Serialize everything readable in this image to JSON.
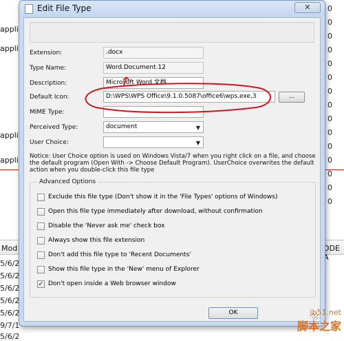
{
  "background": {
    "left_words": [
      "applic",
      "applic",
      "applic",
      "applic"
    ],
    "right_numbers": [
      "0",
      "0",
      "0",
      "0",
      "0",
      "0",
      "0",
      "0",
      "0",
      "0",
      "0",
      "0",
      "0",
      "0",
      "0"
    ],
    "table": {
      "col_left": "Mod",
      "col_right": "DDE A",
      "dates": [
        "5/6/2",
        "5/6/2",
        "5/6/2",
        "5/6/2",
        "5/6/2",
        "9/7/1",
        "5/6/2"
      ]
    }
  },
  "dialog": {
    "title": "Edit File Type",
    "close_label": "✕",
    "fields": {
      "extension_label": "Extension:",
      "extension_value": ".docx",
      "typename_label": "Type Name:",
      "typename_value": "Word.Document.12",
      "description_label": "Description:",
      "description_value": "Microsoft Word 文档",
      "icon_label": "Default Icon:",
      "icon_value": "D:\\WPS\\WPS Office\\9.1.0.5087\\office6\\wps.exe,3",
      "browse_label": "...",
      "mime_label": "MIME Type:",
      "mime_value": "",
      "perceived_label": "Perceived Type:",
      "perceived_value": "document",
      "userchoice_label": "User Choice:",
      "userchoice_value": ""
    },
    "notice": "Notice: User Choice option is used on Windows Vista/7 when you right click on a file, and choose the default program (Open With -> Choose Default Program). UserChoice overwrites the default action when you double-click this file type",
    "advanced": {
      "title": "Advanced Options",
      "options": [
        {
          "label": "Exclude  this file type (Don't show it in the 'File Types' options of Windows)",
          "checked": false
        },
        {
          "label": "Open this file type immediately after download, without confirmation",
          "checked": false
        },
        {
          "label": "Disable the 'Never ask me' check box",
          "checked": false
        },
        {
          "label": "Always show this file extension",
          "checked": false
        },
        {
          "label": "Don't add this file type to 'Recent Documents'",
          "checked": false
        },
        {
          "label": "Show this file type in the 'New' menu of Explorer",
          "checked": false
        },
        {
          "label": "Don't open inside a Web browser window",
          "checked": true
        }
      ]
    },
    "ok_label": "OK"
  },
  "watermark": {
    "line1": "jb51.net",
    "line2": "脚本之家"
  },
  "colors": {
    "annotation_red": "#d4141b",
    "dialog_frame": "#c7daf0"
  }
}
